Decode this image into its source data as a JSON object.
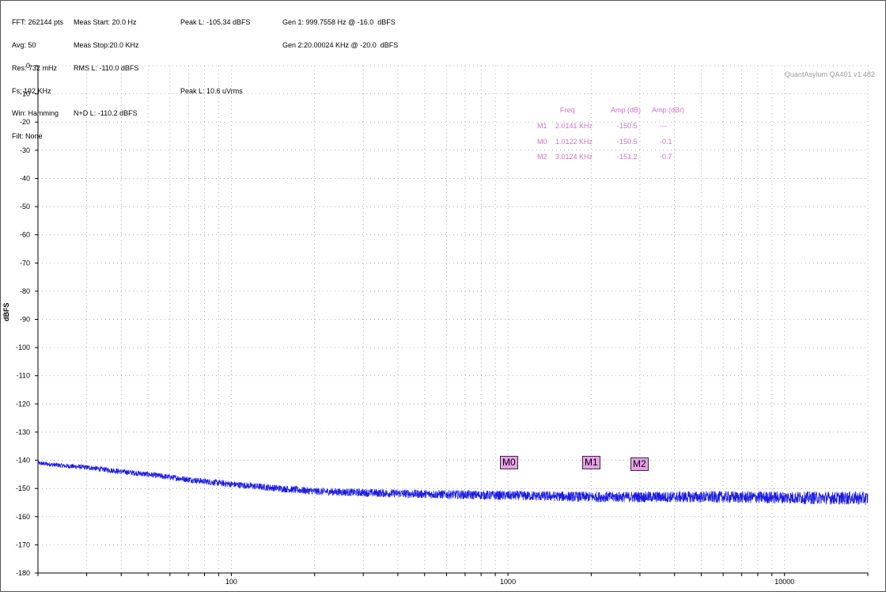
{
  "header": {
    "col1": [
      "FFT: 262144 pts",
      "Avg: 50",
      "Res: 732 mHz",
      "Fs: 192 KHz",
      "Win: Hamming",
      "Filt: None"
    ],
    "col2": [
      "Meas Start: 20.0 Hz",
      "Meas Stop:20.0 KHz",
      "RMS L: -110.0 dBFS",
      "",
      "N+D L: -110.2 dBFS"
    ],
    "col3": [
      "Peak L: -105.34 dBFS",
      "",
      "",
      "Peak L: 10.6 uVrms"
    ],
    "col4": [
      "Gen 1: 999.7558 Hz @ -16.0  dBFS",
      "Gen 2:20.00024 KHz @ -20.0  dBFS"
    ]
  },
  "watermark": "QuantAsylum QA401 v1.482",
  "markers_table": {
    "headers": [
      "Freq",
      "Amp (dB)",
      "Amp (dBr)"
    ],
    "rows": [
      {
        "name": "M1",
        "freq": "2.0141 KHz",
        "amp_db": "-150.5",
        "amp_dbr": "---"
      },
      {
        "name": "M0",
        "freq": "1.0122 KHz",
        "amp_db": "-150.5",
        "amp_dbr": "-0.1"
      },
      {
        "name": "M2",
        "freq": "3.0124 KHz",
        "amp_db": "-151.2",
        "amp_dbr": "-0.7"
      }
    ]
  },
  "marker_labels": [
    "M0",
    "M1",
    "M2"
  ],
  "colors": {
    "trace": "#1a1ae6",
    "marker": "#e8a0e8",
    "marker_text": "#d070d0",
    "grid": "#9a9a9a"
  },
  "chart_data": {
    "type": "line",
    "title": "",
    "xlabel": "",
    "ylabel": "dBFS",
    "xscale": "log",
    "xlim": [
      20,
      20000
    ],
    "ylim": [
      -180,
      0
    ],
    "yticks": [
      0,
      -10,
      -20,
      -30,
      -40,
      -50,
      -60,
      -70,
      -80,
      -90,
      -100,
      -110,
      -120,
      -130,
      -140,
      -150,
      -160,
      -170,
      -180
    ],
    "xtick_labels": [
      "100",
      "1000",
      "10000"
    ],
    "grid": true,
    "series": [
      {
        "x": [
          20,
          25,
          30,
          40,
          50,
          60,
          80,
          100,
          150,
          200,
          300,
          500,
          1000,
          2000,
          5000,
          10000,
          20000
        ],
        "y": [
          -141,
          -142,
          -142.5,
          -144,
          -145,
          -146,
          -147.5,
          -148.5,
          -150,
          -151,
          -151.5,
          -152,
          -152.5,
          -153,
          -153,
          -153.2,
          -153.5
        ]
      }
    ],
    "markers": [
      {
        "name": "M0",
        "x": 1012.2,
        "y": -150.5
      },
      {
        "name": "M1",
        "x": 2014.1,
        "y": -150.5
      },
      {
        "name": "M2",
        "x": 3012.4,
        "y": -151.2
      }
    ]
  }
}
